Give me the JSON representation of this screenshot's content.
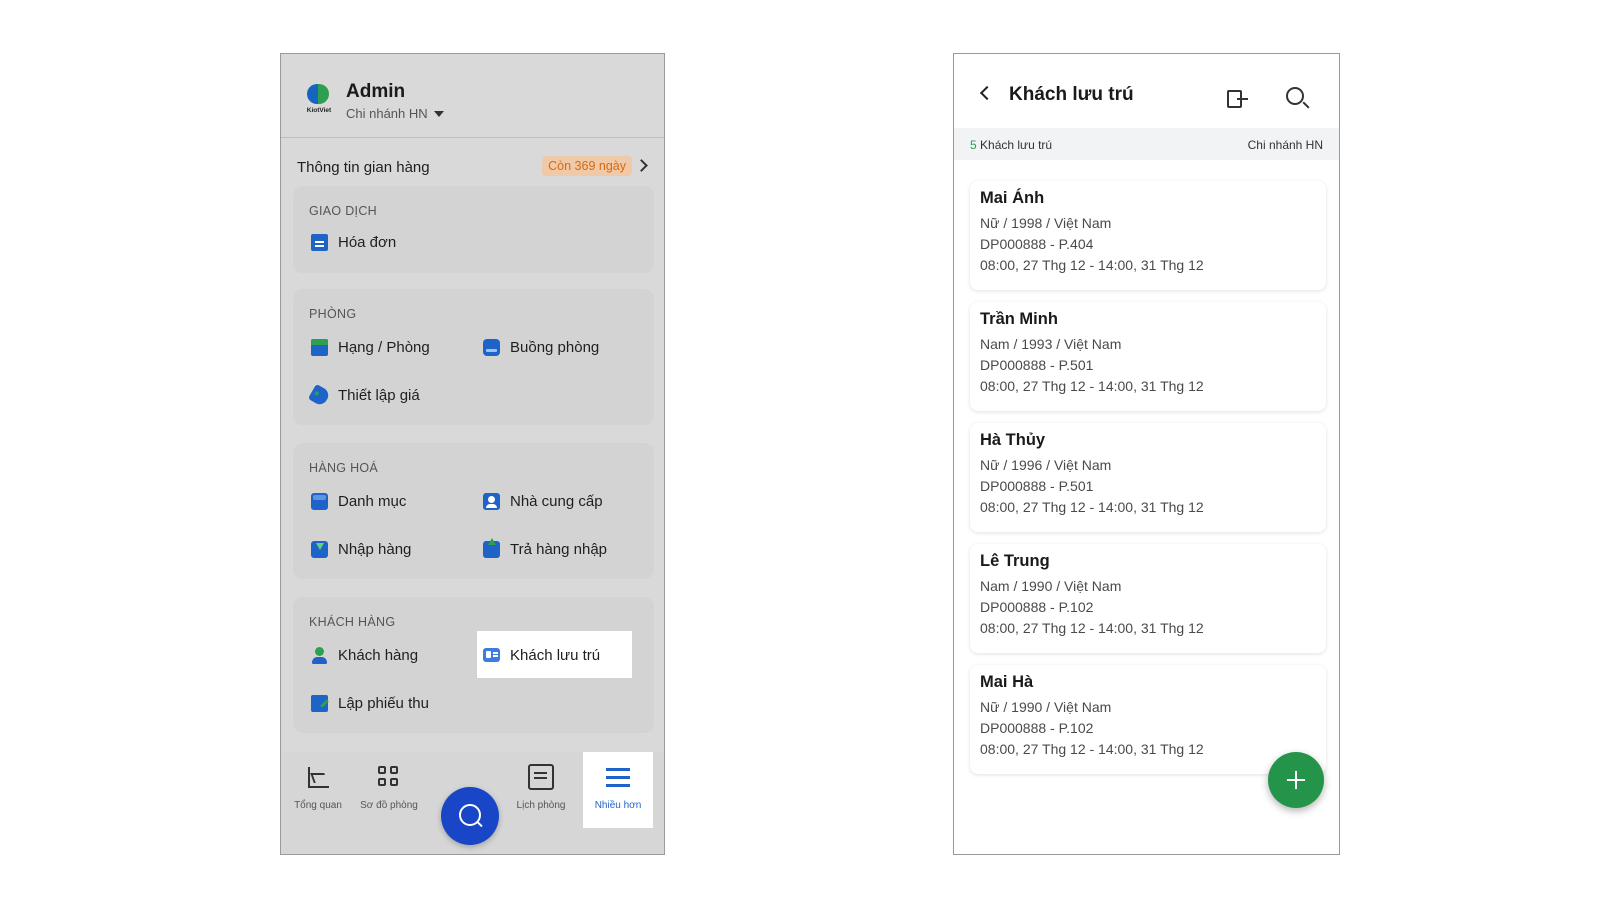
{
  "left": {
    "header": {
      "logo_text": "KiotViet",
      "user": "Admin",
      "branch": "Chi nhánh HN"
    },
    "store_info": {
      "label": "Thông tin gian hàng",
      "badge": "Còn 369 ngày"
    },
    "sections": {
      "transactions": {
        "title": "GIAO DỊCH",
        "items": [
          "Hóa đơn"
        ]
      },
      "rooms": {
        "title": "PHÒNG",
        "items": [
          "Hạng / Phòng",
          "Buồng phòng",
          "Thiết lập giá"
        ]
      },
      "goods": {
        "title": "HÀNG HOÁ",
        "items": [
          "Danh mục",
          "Nhà cung cấp",
          "Nhập hàng",
          "Trả hàng nhập"
        ]
      },
      "customers": {
        "title": "KHÁCH HÀNG",
        "items": [
          "Khách hàng",
          "Khách lưu trú",
          "Lập phiếu thu"
        ]
      }
    },
    "bottom_nav": [
      "Tổng quan",
      "Sơ đồ phòng",
      "Lịch phòng",
      "Nhiều hơn"
    ]
  },
  "right": {
    "title": "Khách lưu trú",
    "count_num": "5",
    "count_label": "Khách lưu trú",
    "branch": "Chi nhánh HN",
    "guests": [
      {
        "name": "Mai Ánh",
        "info": "Nữ / 1998 / Việt Nam",
        "booking": "DP000888 - P.404",
        "time": "08:00, 27 Thg 12 - 14:00, 31 Thg 12"
      },
      {
        "name": "Trần Minh",
        "info": "Nam / 1993 / Việt Nam",
        "booking": "DP000888 - P.501",
        "time": "08:00, 27 Thg 12 - 14:00, 31 Thg 12"
      },
      {
        "name": "Hà Thủy",
        "info": "Nữ / 1996 / Việt Nam",
        "booking": "DP000888 - P.501",
        "time": "08:00, 27 Thg 12 - 14:00, 31 Thg 12"
      },
      {
        "name": "Lê Trung",
        "info": "Nam / 1990 / Việt Nam",
        "booking": "DP000888 - P.102",
        "time": "08:00, 27 Thg 12 - 14:00, 31 Thg 12"
      },
      {
        "name": "Mai Hà",
        "info": "Nữ / 1990 / Việt Nam",
        "booking": "DP000888 - P.102",
        "time": "08:00, 27 Thg 12 - 14:00, 31 Thg 12"
      }
    ]
  }
}
